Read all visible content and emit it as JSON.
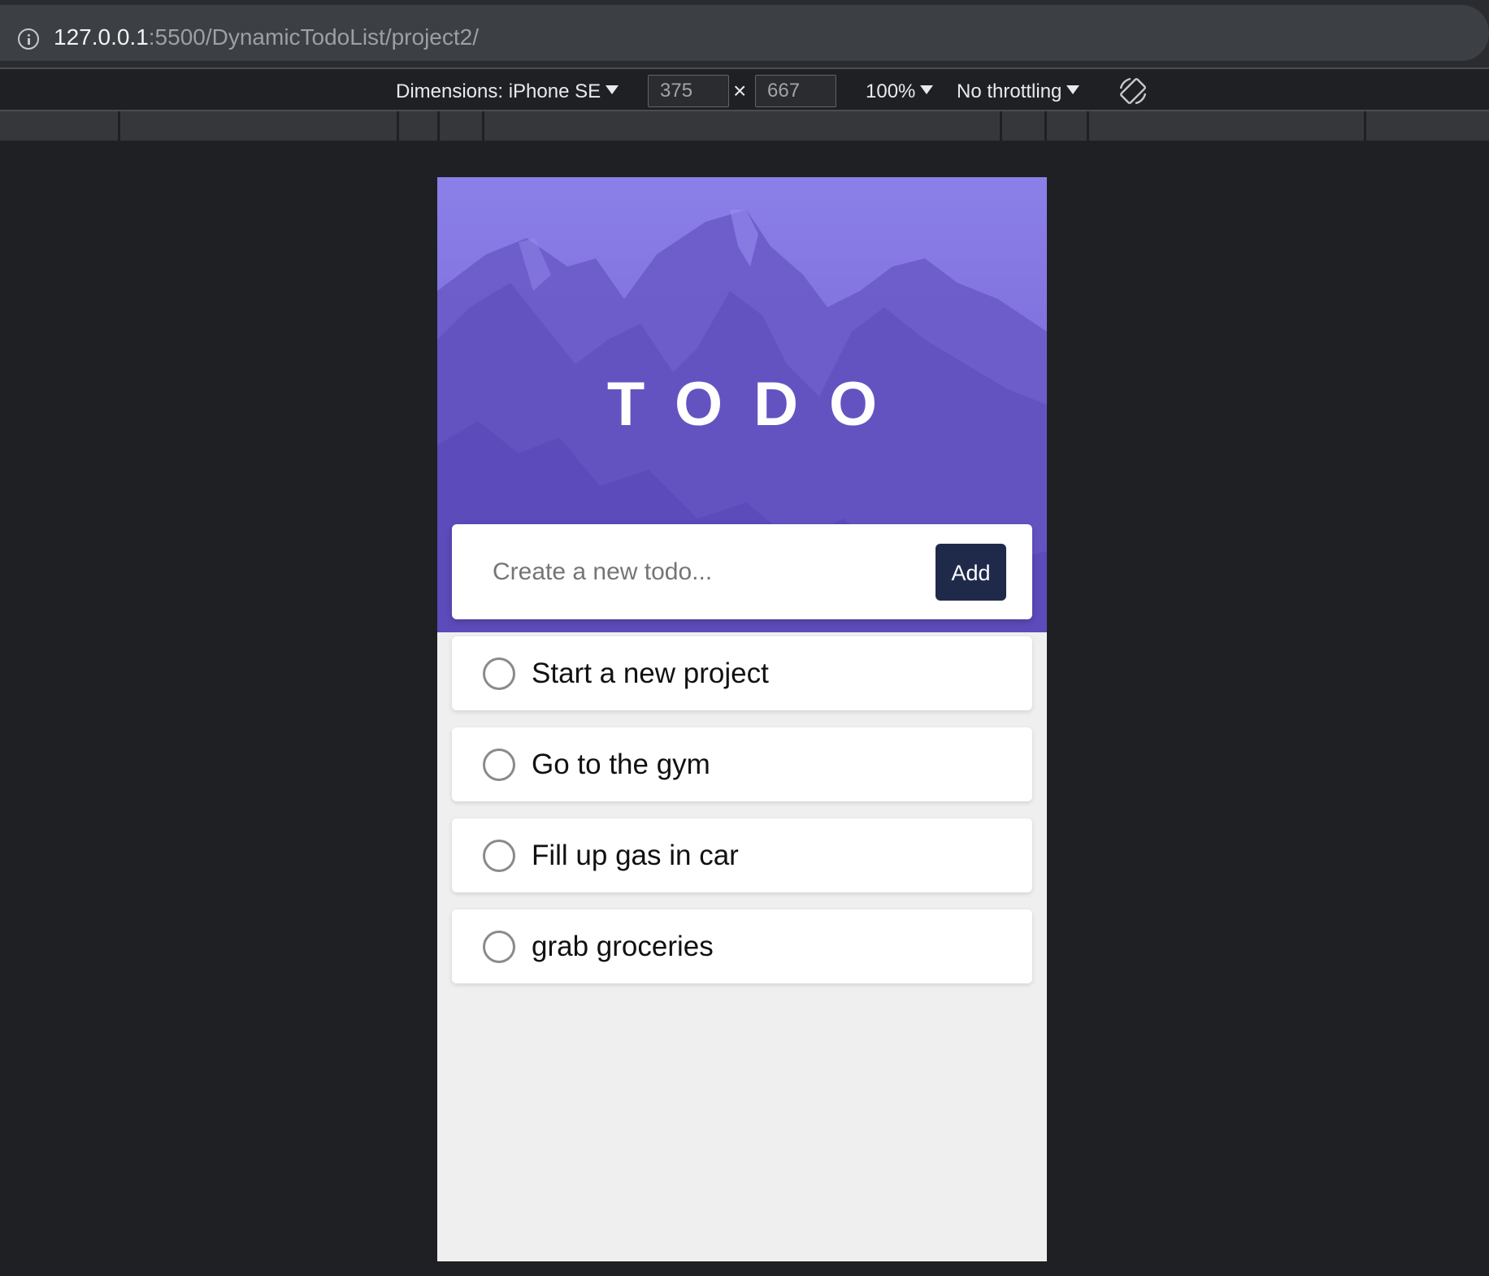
{
  "browser": {
    "url_host": "127.0.0.1",
    "url_rest": ":5500/DynamicTodoList/project2/"
  },
  "devtools": {
    "dimensions_label": "Dimensions: iPhone SE",
    "width_value": "375",
    "times": "×",
    "height_value": "667",
    "zoom_label": "100%",
    "throttling_label": "No throttling"
  },
  "app": {
    "title": "TODO",
    "input_placeholder": "Create a new todo...",
    "add_label": "Add",
    "todos": [
      {
        "text": "Start a new project",
        "done": false
      },
      {
        "text": "Go to the gym",
        "done": false
      },
      {
        "text": "Fill up gas in car",
        "done": false
      },
      {
        "text": "grab groceries",
        "done": false
      }
    ]
  },
  "colors": {
    "hero": "#7a6ad8",
    "add_button": "#1f2a4b",
    "list_bg": "#efefef",
    "devtools_bg": "#1f2023"
  }
}
